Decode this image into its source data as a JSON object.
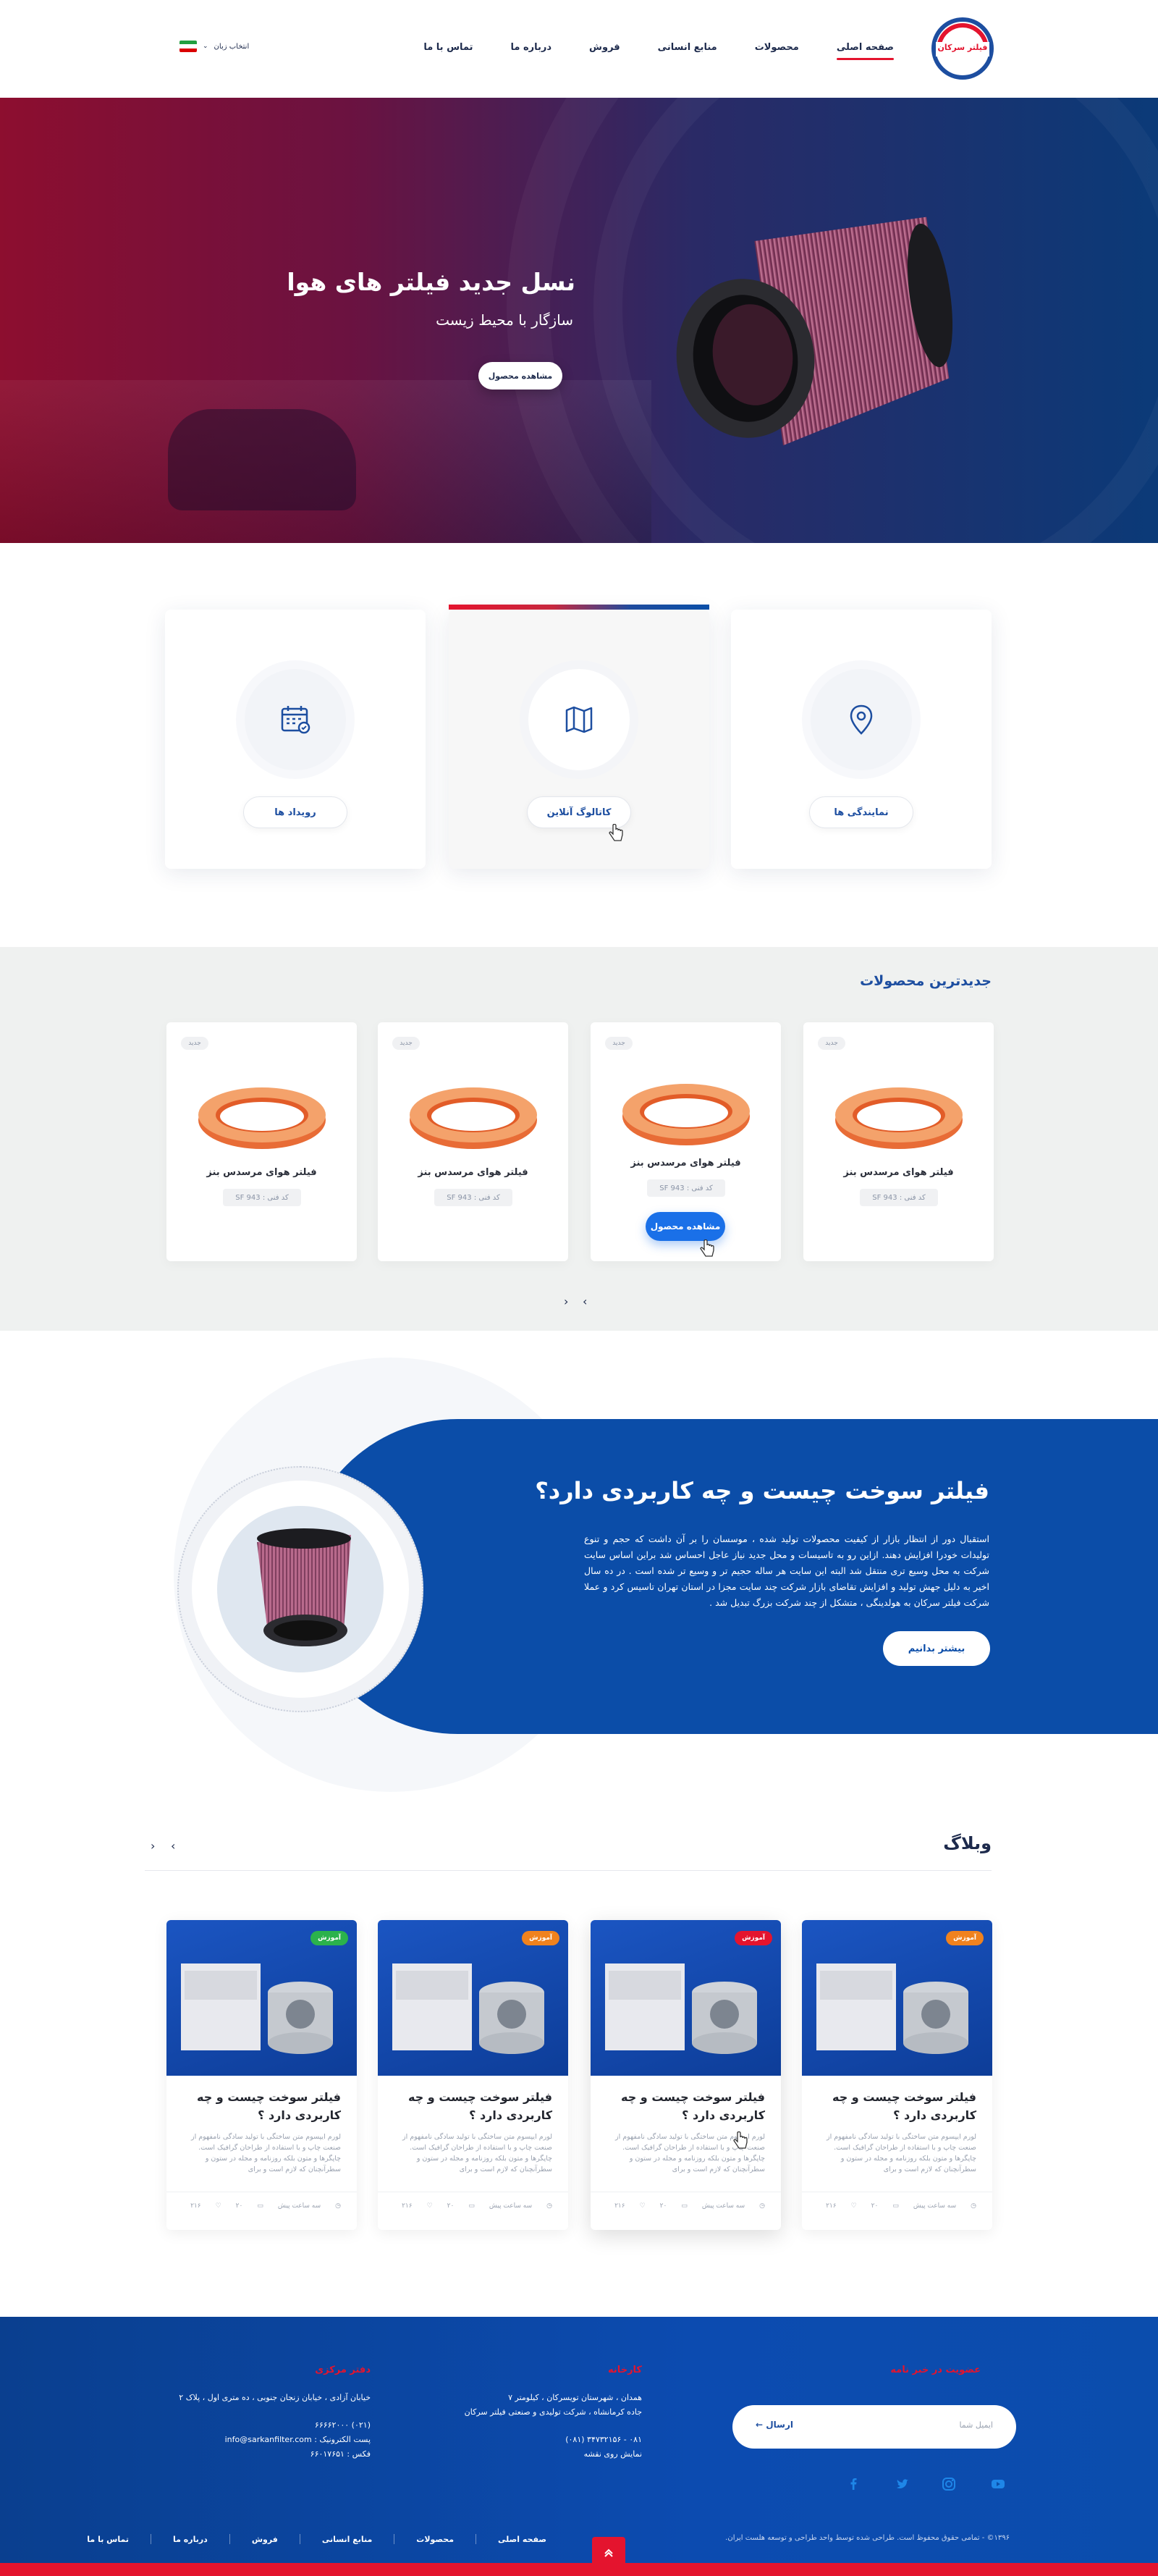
{
  "header": {
    "logo_text": "فیلتر سرکان",
    "nav": [
      "صفحه اصلی",
      "محصولات",
      "منابع انسانی",
      "فروش",
      "درباره ما",
      "تماس با ما"
    ],
    "active_nav": "صفحه اصلی",
    "language_label": "انتخاب زبان"
  },
  "hero": {
    "title": "نسل جدید فیلتر های هوا",
    "subtitle": "سازگار با محیط زیست",
    "button": "مشاهده محصول"
  },
  "features": [
    {
      "label": "نمایندگی ها",
      "icon": "location-pin-icon"
    },
    {
      "label": "کاتالوگ آنلاین",
      "icon": "map-icon"
    },
    {
      "label": "رویداد ها",
      "icon": "calendar-icon"
    }
  ],
  "products": {
    "title": "جدیدترین محصولات",
    "items": [
      {
        "badge": "جدید",
        "name": "فیلتر هوای مرسدس بنز",
        "code": "کد فنی : SF 943"
      },
      {
        "badge": "جدید",
        "name": "فیلتر هوای مرسدس بنز",
        "code": "کد فنی : SF 943",
        "button": "مشاهده محصول"
      },
      {
        "badge": "جدید",
        "name": "فیلتر هوای مرسدس بنز",
        "code": "کد فنی : SF 943"
      },
      {
        "badge": "جدید",
        "name": "فیلتر هوای مرسدس بنز",
        "code": "کد فنی : SF 943"
      }
    ]
  },
  "about": {
    "title": "فیلتر سوخت چیست و چه کاربردی دارد؟",
    "text": "استقبال دور از انتظار بازار از کیفیت محصولات تولید شده ، موسسان را بر آن داشت که حجم و تنوع تولیدات  خودرا افزایش دهند. ازاین رو به  تاسیسات و محل جدید نیاز عاجل احساس شد براین اساس سایت شرکت به محل وسیع تری منتقل شد البته این سایت هر ساله حجیم تر و وسیع تر شده است .  در ده سال اخیر به دلیل جهش تولید و افزایش تقاضای بازار شرکت چند سایت مجزا در استان تهران تاسیس کرد و عملا شرکت فیلتر سرکان به هولدینگی ، متشکل از چند شرکت بزرگ تبدیل شد .",
    "button": "بیشتر بدانیم"
  },
  "blog": {
    "title": "وبلاگ",
    "items": [
      {
        "tag": "آموزش",
        "tag_color": "#f0821e",
        "title": "فیلتر سوخت چیست و چه کاربردی دارد ؟",
        "text": "لورم ایپسوم متن ساختگی با تولید سادگی نامفهوم از صنعت چاپ و با استفاده از طراحان گرافیک است. چاپگرها و متون بلکه روزنامه و مجله در ستون و سطرآنچنان که لازم است و برای",
        "time": "سه ساعت پیش",
        "comments": "۲۰",
        "likes": "۲۱۶"
      },
      {
        "tag": "آموزش",
        "tag_color": "#e4142e",
        "title": "فیلتر سوخت چیست و چه کاربردی دارد ؟",
        "text": "لورم ایپسوم متن ساختگی با تولید سادگی نامفهوم از صنعت چاپ و با استفاده از طراحان گرافیک است. چاپگرها و متون بلکه روزنامه و مجله در ستون و سطرآنچنان که لازم است و برای",
        "time": "سه ساعت پیش",
        "comments": "۲۰",
        "likes": "۲۱۶"
      },
      {
        "tag": "آموزش",
        "tag_color": "#f0821e",
        "title": "فیلتر سوخت چیست و چه کاربردی دارد ؟",
        "text": "لورم ایپسوم متن ساختگی با تولید سادگی نامفهوم از صنعت چاپ و با استفاده از طراحان گرافیک است. چاپگرها و متون بلکه روزنامه و مجله در ستون و سطرآنچنان که لازم است و برای",
        "time": "سه ساعت پیش",
        "comments": "۲۰",
        "likes": "۲۱۶"
      },
      {
        "tag": "آموزش",
        "tag_color": "#2bb24c",
        "title": "فیلتر سوخت چیست و چه کاربردی دارد ؟",
        "text": "لورم ایپسوم متن ساختگی با تولید سادگی نامفهوم از صنعت چاپ و با استفاده از طراحان گرافیک است. چاپگرها و متون بلکه روزنامه و مجله در ستون و سطرآنچنان که لازم است و برای",
        "time": "سه ساعت پیش",
        "comments": "۲۰",
        "likes": "۲۱۶"
      }
    ]
  },
  "footer": {
    "newsletter_title": "عضویت در خبر نامه",
    "newsletter_placeholder": "ایمیل شما",
    "newsletter_button": "ارسال",
    "factory_title": "کارخانه",
    "factory_address_1": "همدان ، شهرستان تویسرکان ، کیلومتر ۷",
    "factory_address_2": "جاده کرمانشاه ، شرکت تولیدی و صنعتی فیلتر سرکان",
    "factory_phone": "۰۸۱ - ۳۴۷۳۲۱۵۶ (۰۸۱)",
    "factory_map": "نمایش روی نقشه",
    "office_title": "دفتر مرکزی",
    "office_address": "خیابان آزادی ، خیابان زنجان جنوبی ، ده متری اول ، پلاک ۲",
    "office_phone": "(۰۲۱) ۶۶۶۶۲۰۰۰",
    "office_email_label": "پست الکترونیک : info@sarkanfilter.com",
    "office_fax": "فکس : ۶۶۰۱۷۶۵۱",
    "nav": [
      "صفحه اصلی",
      "محصولات",
      "منابع انسانی",
      "فروش",
      "درباره ما",
      "تماس با ما"
    ],
    "copyright": "۱۳۹۶© - تمامی حقوق محفوظ است. طراحی شده توسط واحد طراحی و توسعه هلست ایران."
  },
  "colors": {
    "brand_blue": "#0b4da8",
    "brand_red": "#e4142e",
    "button_blue": "#1a70e8"
  }
}
